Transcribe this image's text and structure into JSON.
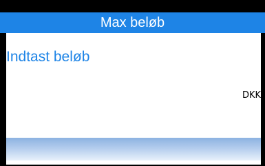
{
  "header": {
    "title": "Max beløb"
  },
  "content": {
    "prompt": "Indtast beløb",
    "currency": "DKK",
    "amount_value": ""
  },
  "colors": {
    "accent": "#1e84e6",
    "frame": "#000000",
    "background": "#ffffff"
  }
}
